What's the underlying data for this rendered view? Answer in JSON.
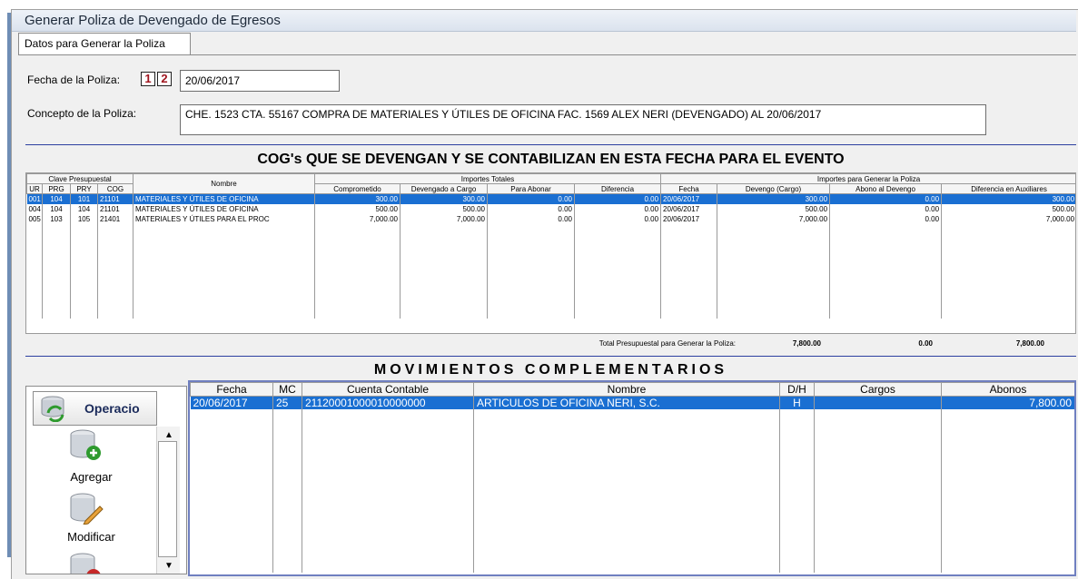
{
  "window": {
    "title": "Generar Poliza de Devengado de Egresos"
  },
  "tab": {
    "label": "Datos para Generar la Poliza"
  },
  "form": {
    "fecha_label": "Fecha de la Poliza:",
    "calendar_digits": [
      "1",
      "2"
    ],
    "fecha_value": "20/06/2017",
    "concepto_label": "Concepto de la Poliza:",
    "concepto_value": "CHE. 1523 CTA. 55167 COMPRA DE MATERIALES Y ÚTILES DE OFICINA FAC. 1569 ALEX NERI (DEVENGADO) AL 20/06/2017"
  },
  "cog": {
    "title": "COG's QUE SE DEVENGAN Y SE CONTABILIZAN EN ESTA FECHA PARA EL EVENTO",
    "groups": {
      "clave": "Clave Presupuestal",
      "nombre": "Nombre",
      "totales": "Importes Totales",
      "poliza": "Importes para Generar la Poliza"
    },
    "columns": [
      "UR",
      "PRG",
      "PRY",
      "COG",
      "Comprometido",
      "Devengado a Cargo",
      "Para Abonar",
      "Diferencia",
      "Fecha",
      "Devengo (Cargo)",
      "Abono al Devengo",
      "Diferencia en Auxiliares"
    ],
    "rows": [
      [
        "001",
        "104",
        "101",
        "21101",
        "MATERIALES Y ÚTILES DE OFICINA",
        "300.00",
        "300.00",
        "0.00",
        "0.00",
        "20/06/2017",
        "300.00",
        "0.00",
        "300.00"
      ],
      [
        "004",
        "104",
        "104",
        "21101",
        "MATERIALES Y ÚTILES DE OFICINA",
        "500.00",
        "500.00",
        "0.00",
        "0.00",
        "20/06/2017",
        "500.00",
        "0.00",
        "500.00"
      ],
      [
        "005",
        "103",
        "105",
        "21401",
        "MATERIALES Y ÚTILES PARA EL PROC",
        "7,000.00",
        "7,000.00",
        "0.00",
        "0.00",
        "20/06/2017",
        "7,000.00",
        "0.00",
        "7,000.00"
      ]
    ],
    "total_label": "Total Presupuestal para Generar la Poliza:",
    "totals": [
      "7,800.00",
      "0.00",
      "7,800.00"
    ]
  },
  "mov": {
    "title": "MOVIMIENTOS COMPLEMENTARIOS",
    "columns": [
      "Fecha",
      "MC",
      "Cuenta Contable",
      "Nombre",
      "D/H",
      "Cargos",
      "Abonos"
    ],
    "rows": [
      [
        "20/06/2017",
        "25",
        "21120001000010000000",
        "ARTICULOS DE OFICINA NERI, S.C.",
        "H",
        "",
        "7,800.00"
      ]
    ]
  },
  "sidebar": {
    "header": "Operacio",
    "buttons": [
      {
        "label": "Agregar",
        "icon": "database-add-icon"
      },
      {
        "label": "Modificar",
        "icon": "database-edit-icon"
      },
      {
        "label": "",
        "icon": "database-delete-icon"
      }
    ]
  },
  "colors": {
    "selection": "#1a6fd2",
    "rule": "#2c3fa0"
  }
}
